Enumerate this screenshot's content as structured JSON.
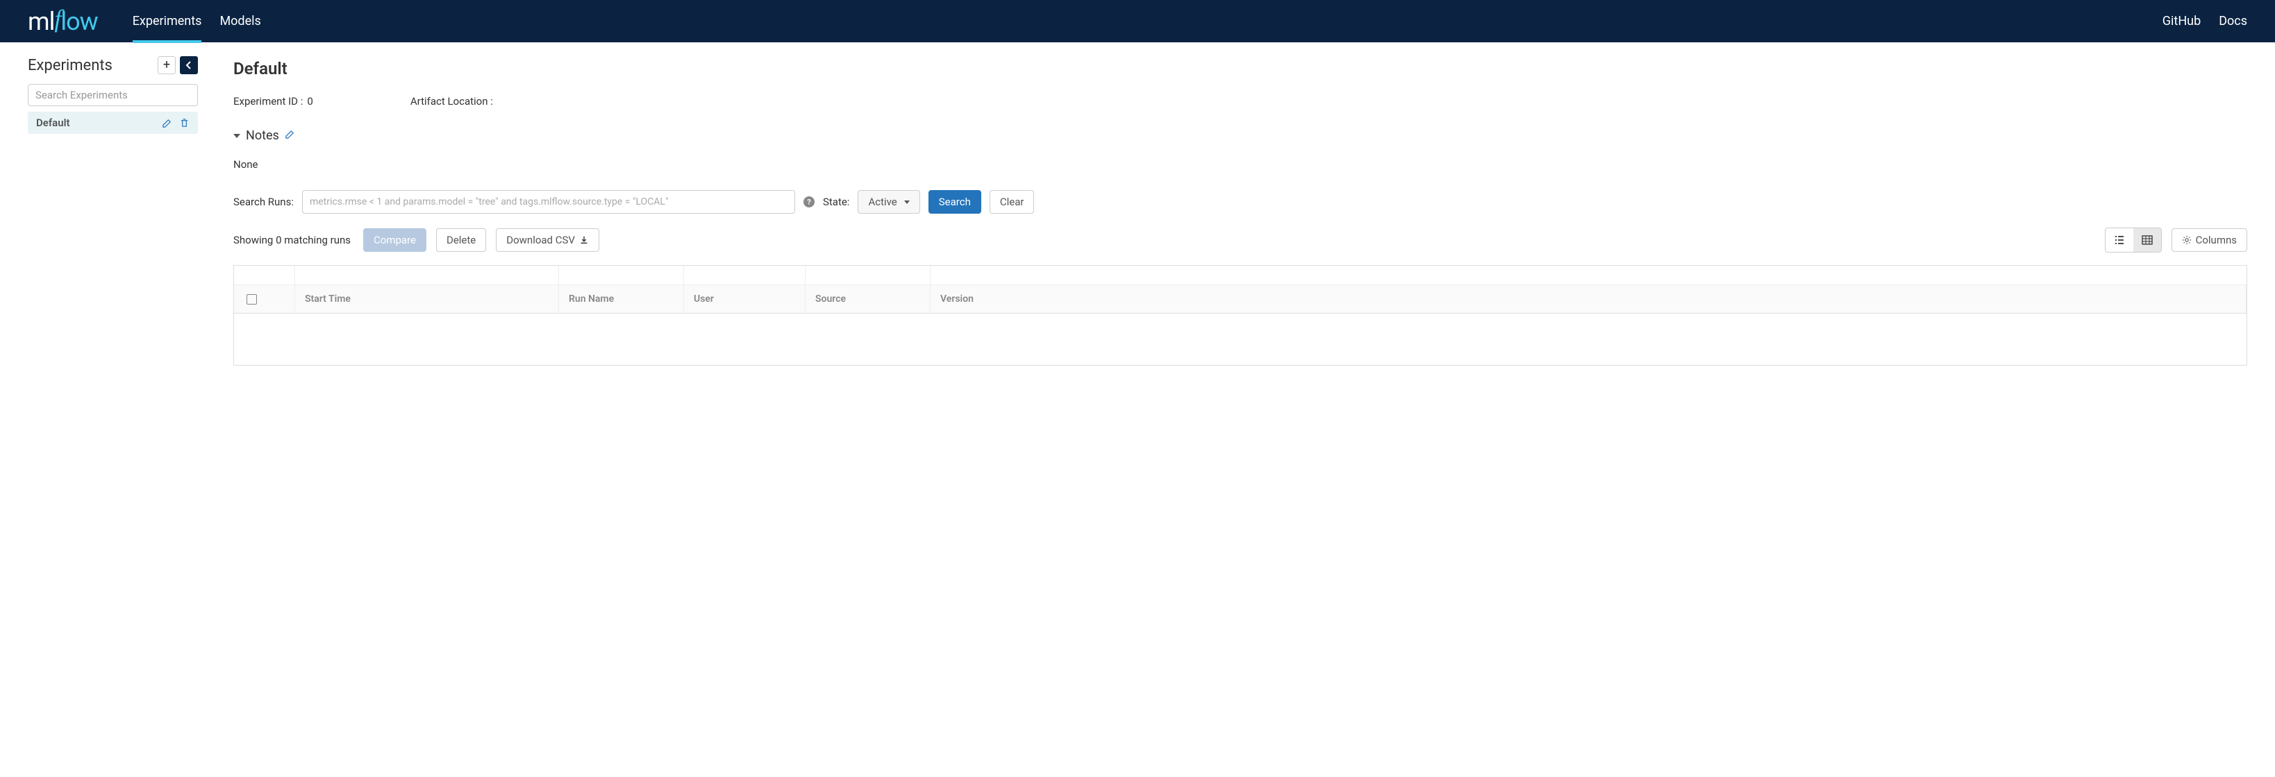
{
  "header": {
    "nav": {
      "experiments": "Experiments",
      "models": "Models"
    },
    "right": {
      "github": "GitHub",
      "docs": "Docs"
    }
  },
  "sidebar": {
    "title": "Experiments",
    "search_placeholder": "Search Experiments",
    "items": [
      {
        "name": "Default"
      }
    ]
  },
  "main": {
    "title": "Default",
    "experiment_id_label": "Experiment ID",
    "experiment_id_value": "0",
    "artifact_location_label": "Artifact Location",
    "artifact_location_value": "",
    "notes_label": "Notes",
    "notes_value": "None",
    "search_label": "Search Runs:",
    "search_placeholder": "metrics.rmse < 1 and params.model = \"tree\" and tags.mlflow.source.type = \"LOCAL\"",
    "state_label": "State:",
    "state_value": "Active",
    "search_btn": "Search",
    "clear_btn": "Clear",
    "matching_text": "Showing 0 matching runs",
    "compare_btn": "Compare",
    "delete_btn": "Delete",
    "download_btn": "Download CSV",
    "columns_btn": "Columns",
    "columns": {
      "start_time": "Start Time",
      "run_name": "Run Name",
      "user": "User",
      "source": "Source",
      "version": "Version"
    }
  }
}
